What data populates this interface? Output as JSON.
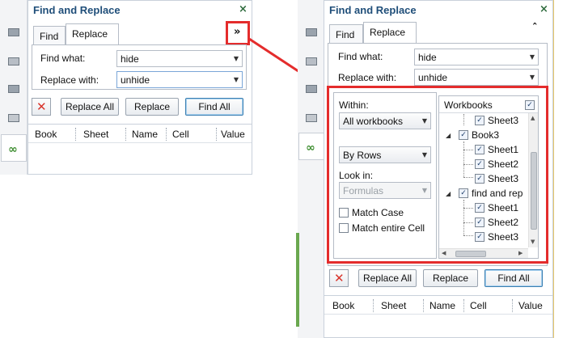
{
  "colors": {
    "accent": "#1f4e79",
    "highlight": "#e42c2c",
    "ok_green": "#3d8d2f"
  },
  "left_panel": {
    "title": "Find and Replace",
    "close_label": "×",
    "expand_icon": "double-chevron-down",
    "tabs": [
      "Find",
      "Replace"
    ],
    "find_label": "Find what:",
    "find_value": "hide",
    "replace_label": "Replace with:",
    "replace_value": "unhide",
    "buttons": {
      "replace_all": "Replace All",
      "replace": "Replace",
      "find_all": "Find All"
    },
    "columns": [
      "Book",
      "Sheet",
      "Name",
      "Cell",
      "Value"
    ]
  },
  "right_panel": {
    "title": "Find and Replace",
    "close_label": "×",
    "collapse_icon": "double-chevron-up",
    "tabs": [
      "Find",
      "Replace"
    ],
    "find_label": "Find what:",
    "find_value": "hide",
    "replace_label": "Replace with:",
    "replace_value": "unhide",
    "options": {
      "within_label": "Within:",
      "within_value": "All workbooks",
      "search_value": "By Rows",
      "look_in_label": "Look in:",
      "look_in_value": "Formulas",
      "match_case": "Match Case",
      "match_entire": "Match entire Cell"
    },
    "tree": {
      "header": "Workbooks",
      "items": [
        "Sheet3",
        "Book3",
        "Sheet1",
        "Sheet2",
        "Sheet3",
        "find and rep",
        "Sheet1",
        "Sheet2",
        "Sheet3"
      ]
    },
    "buttons": {
      "replace_all": "Replace All",
      "replace": "Replace",
      "find_all": "Find All"
    },
    "columns": [
      "Book",
      "Sheet",
      "Name",
      "Cell",
      "Value"
    ]
  }
}
